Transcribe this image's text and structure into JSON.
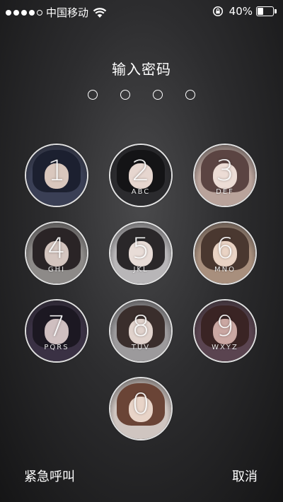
{
  "status_bar": {
    "carrier": "中国移动",
    "battery_text": "40%",
    "battery_level": 0.4,
    "signal_bars_filled": 4,
    "signal_bars_total": 5,
    "icons": [
      "signal-dots",
      "wifi-icon",
      "rotation-lock-icon",
      "battery-icon"
    ]
  },
  "lock_screen": {
    "prompt": "输入密码",
    "passcode_length": 4,
    "entered_digits": 0
  },
  "keypad": {
    "keys": [
      {
        "digit": "1",
        "letters": ""
      },
      {
        "digit": "2",
        "letters": "ABC"
      },
      {
        "digit": "3",
        "letters": "DEF"
      },
      {
        "digit": "4",
        "letters": "GHI"
      },
      {
        "digit": "5",
        "letters": "JKL"
      },
      {
        "digit": "6",
        "letters": "MNO"
      },
      {
        "digit": "7",
        "letters": "PQRS"
      },
      {
        "digit": "8",
        "letters": "TUV"
      },
      {
        "digit": "9",
        "letters": "WXYZ"
      },
      {
        "digit": "0",
        "letters": ""
      }
    ]
  },
  "bottom": {
    "emergency_label": "紧急呼叫",
    "cancel_label": "取消"
  }
}
